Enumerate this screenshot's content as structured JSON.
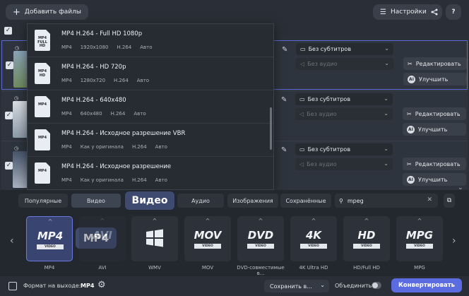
{
  "toolbar": {
    "add_files": "Добавить файлы",
    "settings": "Настройки",
    "help": "?"
  },
  "file_rows": [
    {
      "subtitle": "Без субтитров",
      "audio": "Без аудио",
      "edit": "Редактировать",
      "improve": "Улучшить"
    },
    {
      "subtitle": "Без субтитров",
      "audio": "Без аудио",
      "edit": "Редактировать",
      "improve": "Улучшить"
    },
    {
      "subtitle": "Без субтитров",
      "audio": "Без аудио",
      "edit": "Редактировать",
      "improve": "Улучшить"
    }
  ],
  "presets": [
    {
      "title": "MP4 H.264 - Full HD 1080p",
      "fmt": "MP4",
      "res": "1920x1080",
      "codec": "H.264",
      "bitrate": "Авто",
      "badge": "MP4 FULL HD"
    },
    {
      "title": "MP4 H.264 - HD 720p",
      "fmt": "MP4",
      "res": "1280x720",
      "codec": "H.264",
      "bitrate": "Авто",
      "badge": "MP4 HD"
    },
    {
      "title": "MP4 H.264 - 640x480",
      "fmt": "MP4",
      "res": "640x480",
      "codec": "H.264",
      "bitrate": "Авто",
      "badge": "MP4"
    },
    {
      "title": "MP4 H.264 - Исходное разрешение VBR",
      "fmt": "MP4",
      "res": "Как у оригинала",
      "codec": "H.264",
      "bitrate": "Авто",
      "badge": "MP4"
    },
    {
      "title": "MP4 H.264 - Исходное разрешение",
      "fmt": "MP4",
      "res": "Как у оригинала",
      "codec": "H.264",
      "bitrate": "Авто",
      "badge": "MP4"
    }
  ],
  "tabs": {
    "popular": "Популярные",
    "video": "Видео",
    "audio": "Аудио",
    "images": "Изображения",
    "saved": "Сохранённые"
  },
  "tooltips": {
    "video": "Видео",
    "mp4": "MP4"
  },
  "search": {
    "value": "mpeg"
  },
  "formats": [
    {
      "logo": "MP4",
      "sub": "VIDEO",
      "label": "MP4"
    },
    {
      "logo": "AVI",
      "sub": "",
      "label": "AVI"
    },
    {
      "logo": "",
      "sub": "",
      "label": "WMV"
    },
    {
      "logo": "MOV",
      "sub": "VIDEO",
      "label": "MOV"
    },
    {
      "logo": "DVD",
      "sub": "VIDEO",
      "label": "DVD-совместимые в..."
    },
    {
      "logo": "4K",
      "sub": "VIDEO",
      "label": "4K Ultra HD"
    },
    {
      "logo": "HD",
      "sub": "VIDEO",
      "label": "HD/Full HD"
    },
    {
      "logo": "MPG",
      "sub": "VIDEO",
      "label": "MPG"
    }
  ],
  "bottom": {
    "output_label": "Формат на выходе:",
    "output_value": "MP4",
    "save_to": "Сохранить в...",
    "merge": "Объединить:",
    "convert": "Конвертировать"
  },
  "colors": {
    "accent": "#5b6ce0",
    "background": "#2b3038",
    "tooltip": "#3f4a70"
  }
}
